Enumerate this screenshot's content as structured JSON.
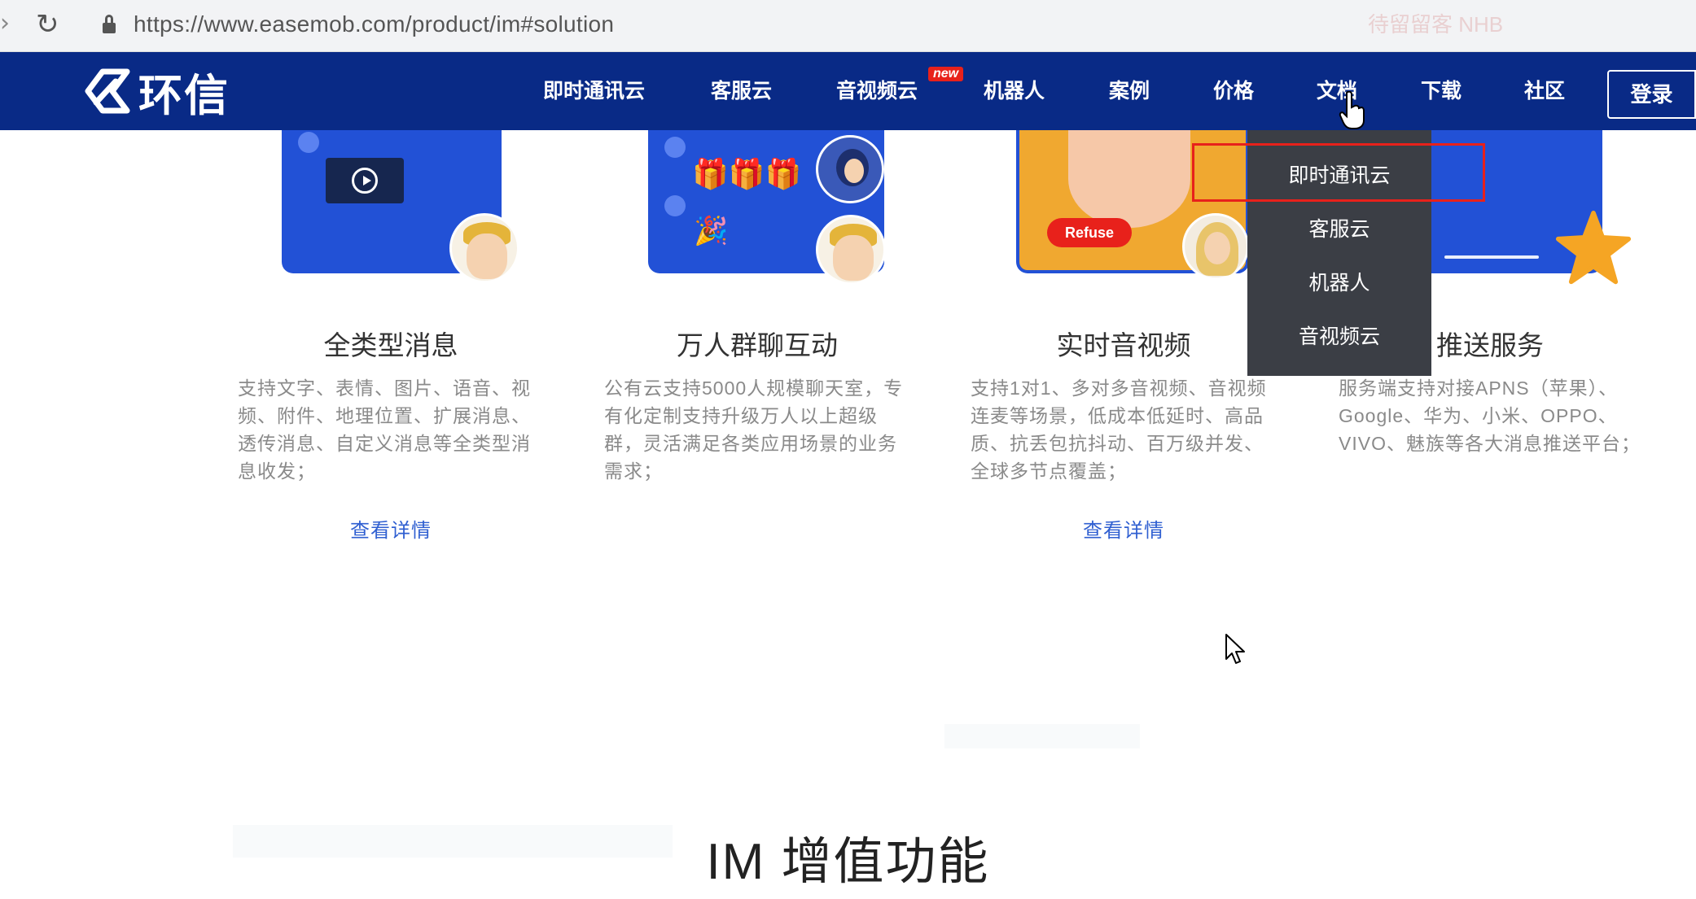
{
  "browser": {
    "url": "https://www.easemob.com/product/im#solution",
    "ghost_text": "待留留客 NHB"
  },
  "header": {
    "logo_text": "环信",
    "nav": [
      "即时通讯云",
      "客服云",
      "音视频云",
      "机器人",
      "案例",
      "价格",
      "文档",
      "下载",
      "社区"
    ],
    "new_badge": "new",
    "login": "登录"
  },
  "dropdown": {
    "items": [
      "即时通讯云",
      "客服云",
      "机器人",
      "音视频云"
    ]
  },
  "cards": [
    {
      "title": "全类型消息",
      "desc": "支持文字、表情、图片、语音、视频、附件、地理位置、扩展消息、透传消息、自定义消息等全类型消息收发；",
      "link": "查看详情"
    },
    {
      "title": "万人群聊互动",
      "desc": "公有云支持5000人规模聊天室，专有化定制支持升级万人以上超级群，灵活满足各类应用场景的业务需求；",
      "link": ""
    },
    {
      "title": "实时音视频",
      "desc": "支持1对1、多对多音视频、音视频连麦等场景，低成本低延时、高品质、抗丢包抗抖动、百万级并发、全球多节点覆盖；",
      "link": "查看详情"
    },
    {
      "title": "推送服务",
      "desc": "服务端支持对接APNS（苹果）、Google、华为、小米、OPPO、VIVO、魅族等各大消息推送平台；",
      "link": ""
    }
  ],
  "illustrations": {
    "refuse_label": "Refuse"
  },
  "section": {
    "title": "IM 增值功能"
  },
  "colors": {
    "header_bg": "#092a86",
    "accent_blue": "#2251d6",
    "link_blue": "#2f5fd1",
    "dropdown_bg": "#3b3e45",
    "highlight_red": "#e8211b"
  }
}
